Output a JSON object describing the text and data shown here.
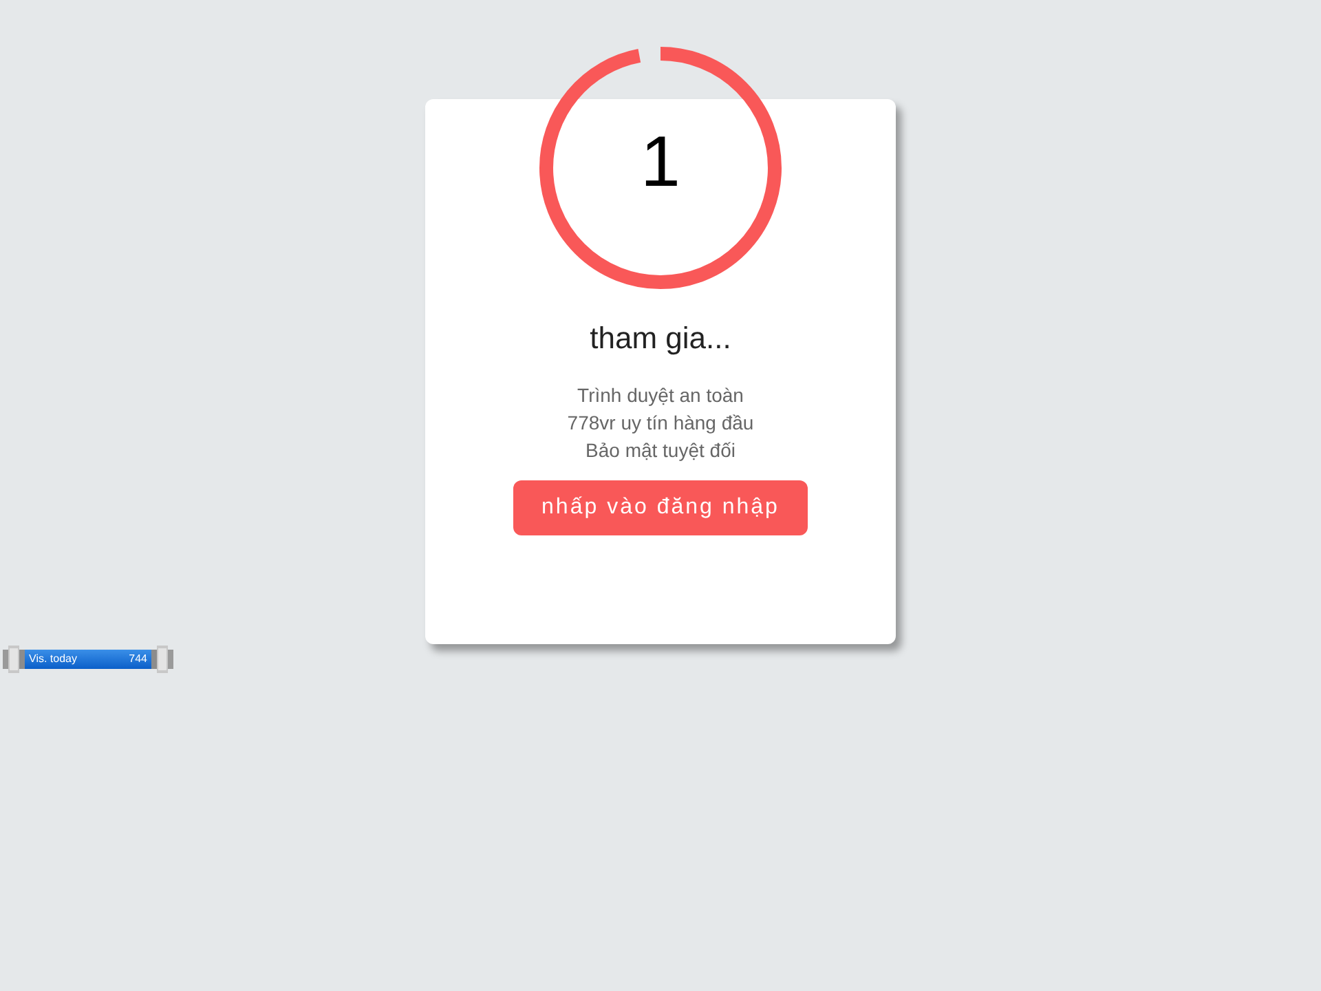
{
  "countdown": {
    "value": "1",
    "level": 0.97
  },
  "title": "tham gia...",
  "features": [
    "Trình duyệt an toàn",
    "778vr uy tín hàng đầu",
    "Bảo mật tuyệt đối"
  ],
  "button": {
    "label": "nhấp vào đăng nhập"
  },
  "visitor_counter": {
    "label": "Vis. today",
    "count": "744"
  }
}
